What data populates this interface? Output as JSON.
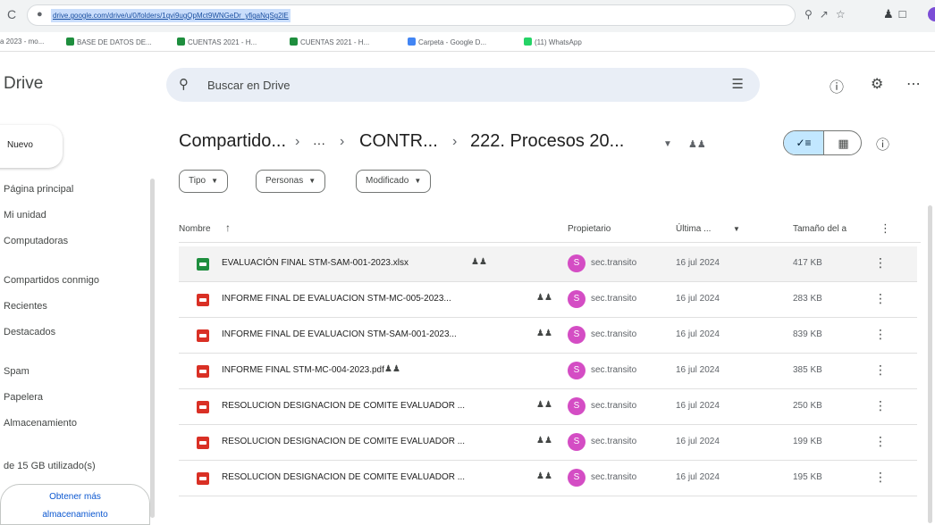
{
  "browser": {
    "url": "drive.google.com/drive/u/0/folders/1qvi9ugQpMct9WNGeDr_yfigaNqSg2lE",
    "bookmarks": [
      {
        "label": "a 2023 - mo...",
        "color": ""
      },
      {
        "label": "BASE DE DATOS DE...",
        "color": "#1e8e3e"
      },
      {
        "label": "CUENTAS 2021 - H...",
        "color": "#1e8e3e"
      },
      {
        "label": "CUENTAS 2021 - H...",
        "color": "#1e8e3e"
      },
      {
        "label": "Carpeta - Google D...",
        "color": "#4285f4"
      },
      {
        "label": "(11) WhatsApp",
        "color": "#25d366"
      }
    ]
  },
  "drive": {
    "title": "Drive",
    "search_placeholder": "Buscar en Drive",
    "new_label": "Nuevo",
    "nav": [
      "Página principal",
      "Mi unidad",
      "Computadoras",
      "Compartidos conmigo",
      "Recientes",
      "Destacados",
      "Spam",
      "Papelera",
      "Almacenamiento"
    ],
    "storage_text": "de 15 GB utilizado(s)",
    "storage_button": [
      "Obtener más",
      "almacenamiento"
    ]
  },
  "breadcrumb": {
    "root": "Compartido...",
    "ellipsis": "···",
    "middle": "CONTR...",
    "current": "222. Procesos 20..."
  },
  "filters": [
    "Tipo",
    "Personas",
    "Modificado"
  ],
  "table": {
    "headers": {
      "name": "Nombre",
      "owner": "Propietario",
      "modified": "Última ...",
      "size": "Tamaño del a"
    },
    "rows": [
      {
        "name": "EVALUACIÓN FINAL STM-SAM-001-2023.xlsx",
        "type": "xlsx",
        "owner": "sec.transito",
        "avatar": "S",
        "date": "16 jul 2024",
        "size": "417 KB"
      },
      {
        "name": "INFORME FINAL DE EVALUACION STM-MC-005-2023...",
        "type": "pdf",
        "owner": "sec.transito",
        "avatar": "S",
        "date": "16 jul 2024",
        "size": "283 KB"
      },
      {
        "name": "INFORME FINAL DE EVALUACION STM-SAM-001-2023...",
        "type": "pdf",
        "owner": "sec.transito",
        "avatar": "S",
        "date": "16 jul 2024",
        "size": "839 KB"
      },
      {
        "name": "INFORME FINAL STM-MC-004-2023.pdf",
        "type": "pdf",
        "owner": "sec.transito",
        "avatar": "S",
        "date": "16 jul 2024",
        "size": "385 KB"
      },
      {
        "name": "RESOLUCION DESIGNACION DE COMITE EVALUADOR ...",
        "type": "pdf",
        "owner": "sec.transito",
        "avatar": "S",
        "date": "16 jul 2024",
        "size": "250 KB"
      },
      {
        "name": "RESOLUCION DESIGNACION DE COMITE EVALUADOR ...",
        "type": "pdf",
        "owner": "sec.transito",
        "avatar": "S",
        "date": "16 jul 2024",
        "size": "199 KB"
      },
      {
        "name": "RESOLUCION DESIGNACION DE COMITE EVALUADOR ...",
        "type": "pdf",
        "owner": "sec.transito",
        "avatar": "S",
        "date": "16 jul 2024",
        "size": "195 KB"
      }
    ]
  },
  "icons": {
    "reload": "reload-icon",
    "lock": "lock-icon",
    "search": "search-icon",
    "tune": "tune-icon",
    "help": "help-icon",
    "settings": "settings-icon",
    "apps": "apps-icon",
    "shared": "shared-people-icon",
    "more": "more-vert-icon",
    "info": "info-icon",
    "sort": "arrow-up-icon"
  },
  "colors": {
    "selected_row": "#f3f3f3",
    "view_toggle_active": "#c2e7ff",
    "avatar": "#d44dc4",
    "pdf": "#d93025",
    "xlsx": "#1e8e3e"
  }
}
